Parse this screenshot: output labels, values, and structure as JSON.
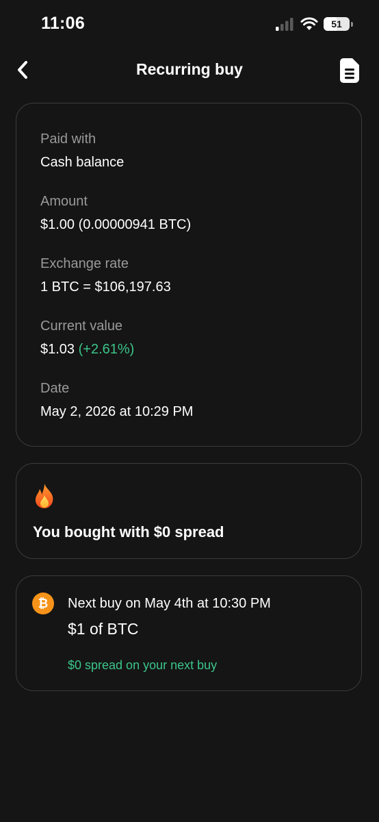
{
  "status_bar": {
    "time": "11:06",
    "battery": "51"
  },
  "nav": {
    "title": "Recurring buy"
  },
  "details": {
    "paid_with_label": "Paid with",
    "paid_with_value": "Cash balance",
    "amount_label": "Amount",
    "amount_value": "$1.00 (0.00000941 BTC)",
    "exchange_rate_label": "Exchange rate",
    "exchange_rate_value": "1 BTC = $106,197.63",
    "current_value_label": "Current value",
    "current_value": "$1.03",
    "current_value_change": "(+2.61%)",
    "date_label": "Date",
    "date_value": "May 2, 2026 at 10:29 PM"
  },
  "spread_card": {
    "icon": "fire-icon",
    "text": "You bought with $0 spread"
  },
  "next_buy": {
    "icon": "bitcoin-icon",
    "icon_glyph": "₿",
    "title": "Next buy on May 4th at 10:30 PM",
    "amount": "$1 of BTC",
    "spread_note": "$0 spread on your next buy"
  },
  "colors": {
    "background": "#151515",
    "card_border": "#3c3c3c",
    "positive": "#3bc58a",
    "bitcoin": "#f7931a",
    "label_gray": "#9a9a9a"
  }
}
